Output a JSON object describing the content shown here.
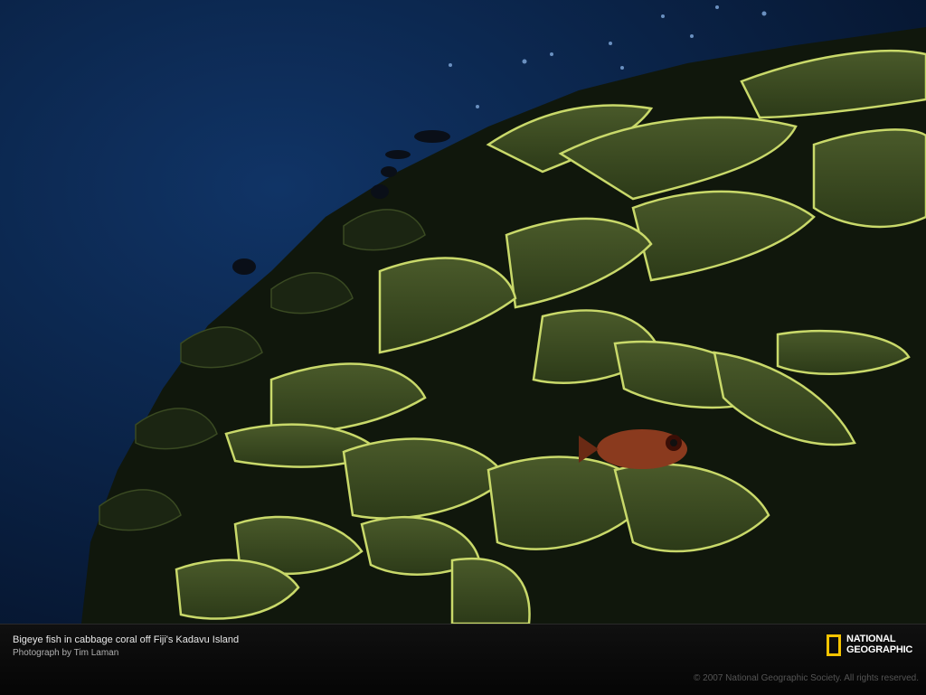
{
  "photo": {
    "subject": "coral-reef-photo"
  },
  "caption": {
    "title": "Bigeye fish in cabbage coral off Fiji's Kadavu Island",
    "credit": "Photograph by Tim Laman"
  },
  "footer": {
    "copyright": "© 2007 National Geographic Society. All rights reserved."
  },
  "logo": {
    "line1": "NATIONAL",
    "line2": "GEOGRAPHIC",
    "frame_color": "#f5c400"
  }
}
